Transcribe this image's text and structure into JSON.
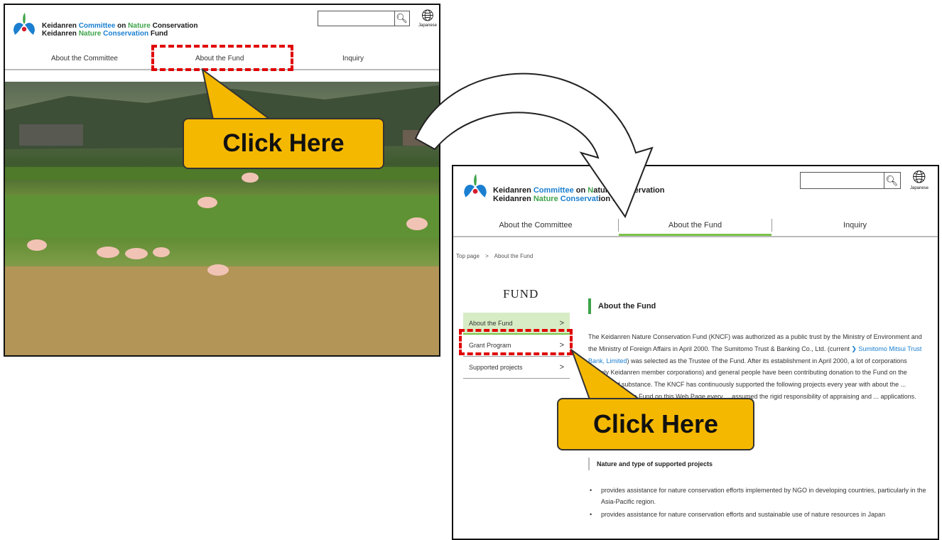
{
  "site": {
    "org_line1": [
      "Keidanren ",
      "Committee",
      " on ",
      "Nature",
      " Conservation"
    ],
    "org_line2": [
      "Keidanren ",
      "Nature",
      " ",
      "Conservation",
      " Fund"
    ],
    "org2_line1": [
      "Keidanren ",
      "Committee",
      " on ",
      "N",
      "ature Conservation"
    ],
    "org2_line2": [
      "Keidanren ",
      "Nature",
      " ",
      "Conservat",
      "ion Fund"
    ],
    "lang_label": "Japanese",
    "search_icon": "search-icon",
    "globe_icon": "globe-icon"
  },
  "nav": {
    "items": [
      "About the Committee",
      "About the Fund",
      "Inquiry"
    ]
  },
  "breadcrumb": {
    "home": "Top page",
    "sep": ">",
    "current": "About the Fund"
  },
  "sidebar": {
    "title": "FUND",
    "items": [
      {
        "label": "About the Fund",
        "chev": ">"
      },
      {
        "label": "Grant Program",
        "chev": ">"
      },
      {
        "label": "Supported projects",
        "chev": ">"
      }
    ]
  },
  "content": {
    "heading": "About the Fund",
    "para_pre": "The Keidanren Nature Conservation Fund (KNCF) was authorized as a public trust by the Ministry of Environment and the Ministry of Foreign Affairs in April 2000. The Sumitomo Trust & Banking Co., Ltd. (current ",
    "para_link": "Sumitomo Mitsui Trust Bank, Limited",
    "para_post": ") was selected as the Trustee of the Fund. After its establishment in April 2000, a lot of corporations (mainly Keidanren member corporations) and general people have been contributing donation to the Fund on the approval of substance. The KNCF has continuously supported the following projects every year with about the ... applicants for the Fund on this Web Page every ... assumed the rigid responsibility of appraising and ... applications.",
    "subheading": "Nature and type of supported projects",
    "bullets": [
      "provides assistance for nature conservation efforts implemented by NGO in developing countries, particularly in the Asia-Pacific region.",
      "provides assistance for nature conservation efforts and sustainable use of nature resources in Japan"
    ]
  },
  "callouts": {
    "first": "Click Here",
    "second": "Click Here"
  },
  "colors": {
    "callout": "#f5b800",
    "highlight": "#e00000",
    "accent_green": "#3ea34a",
    "accent_blue": "#1a7fd0",
    "active_tab": "#7cc24a"
  }
}
